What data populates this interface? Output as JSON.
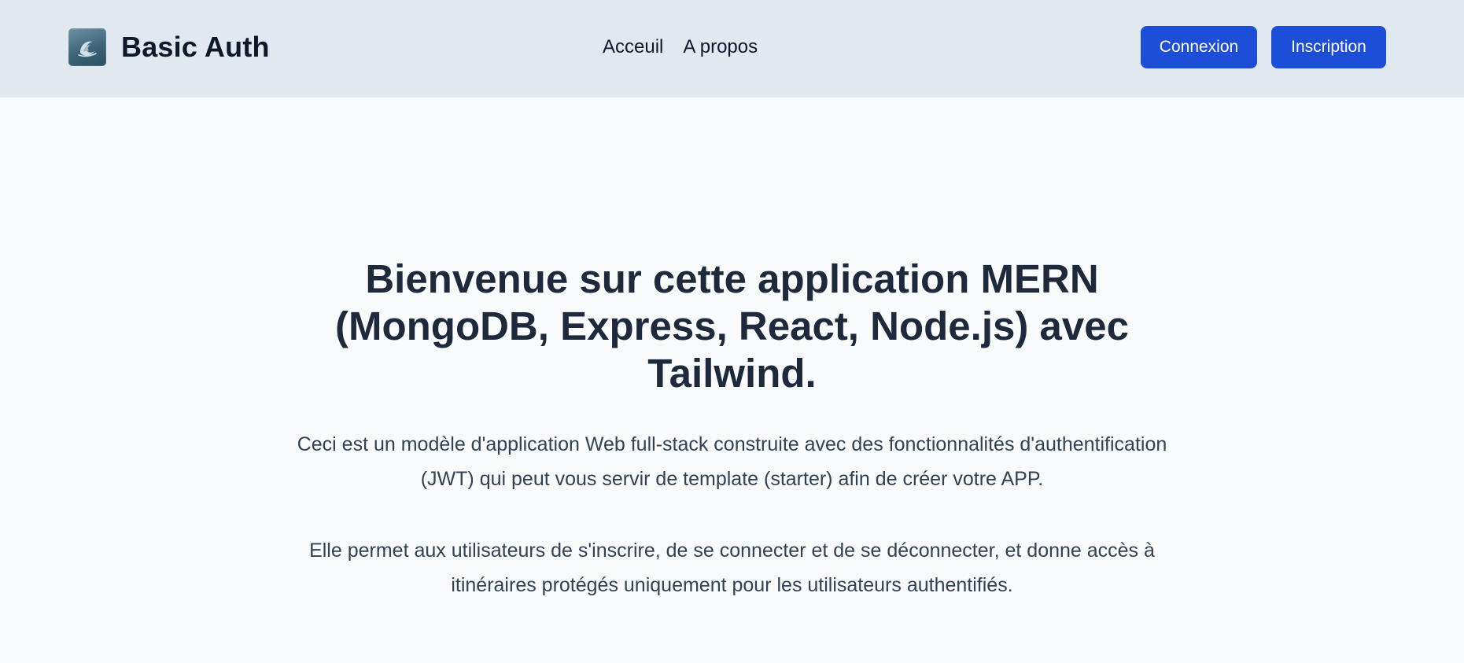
{
  "colors": {
    "navbar_bg": "#e2e8f0",
    "page_bg": "#f8fafc",
    "button_bg": "#1d4ed8",
    "button_text": "#ffffff",
    "title_text": "#1e293b",
    "body_text": "#334155"
  },
  "header": {
    "logo_icon": "wave-icon",
    "brand": "Basic Auth",
    "nav": [
      {
        "label": "Acceuil"
      },
      {
        "label": "A propos"
      }
    ],
    "login_label": "Connexion",
    "signup_label": "Inscription"
  },
  "hero": {
    "title": "Bienvenue sur cette application MERN (MongoDB, Express, React, Node.js) avec Tailwind.",
    "paragraph1": "Ceci est un modèle d'application Web full-stack construite avec des fonctionnalités d'authentification (JWT) qui peut vous servir de template (starter) afin de créer votre APP.",
    "paragraph2": "Elle permet aux utilisateurs de s'inscrire, de se connecter et de se déconnecter, et donne accès à itinéraires protégés uniquement pour les utilisateurs authentifiés."
  }
}
